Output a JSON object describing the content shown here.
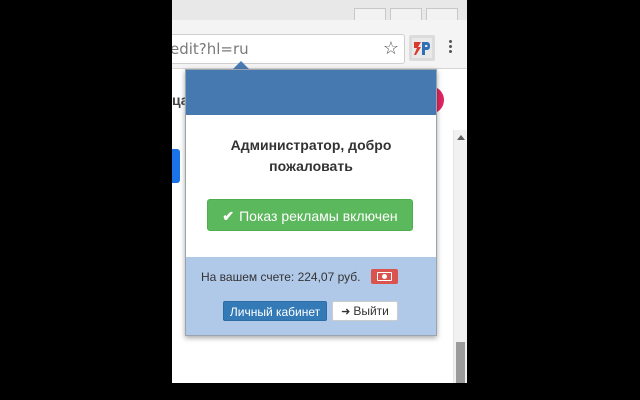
{
  "browser": {
    "url": "edit?hl=ru",
    "star_icon": "star-icon",
    "menu_icon": "kebab-menu-icon",
    "extension_icon": "3p-extension-icon"
  },
  "page": {
    "partial_heading": "ца"
  },
  "popup": {
    "greeting": "Администратор, добро пожаловать",
    "ads_button_icon": "checkmark-icon",
    "ads_button_label": "Показ рекламы включен",
    "balance_text": "На вашем счете: 224,07 руб.",
    "money_icon": "money-icon",
    "cabinet_button_label": "Личный кабинет",
    "logout_icon": "sign-out-icon",
    "logout_button_label": "Выйти"
  },
  "colors": {
    "header_blue": "#4779b1",
    "footer_blue": "#b0c9e8",
    "success_green": "#5cb85c",
    "primary_blue": "#337ab7",
    "danger_red": "#d9534f"
  }
}
